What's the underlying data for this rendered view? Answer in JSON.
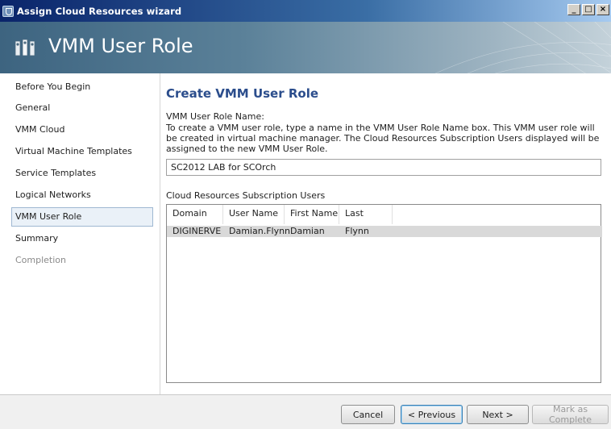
{
  "window": {
    "title": "Assign Cloud Resources wizard",
    "controls": [
      "_",
      "□",
      "×"
    ]
  },
  "banner": {
    "title": "VMM User Role",
    "icon": "users-icon"
  },
  "sidebar": {
    "items": [
      {
        "label": "Before You Begin",
        "state": "normal"
      },
      {
        "label": "General",
        "state": "normal"
      },
      {
        "label": "VMM  Cloud",
        "state": "normal"
      },
      {
        "label": "Virtual Machine Templates",
        "state": "normal"
      },
      {
        "label": "Service Templates",
        "state": "normal"
      },
      {
        "label": "Logical Networks",
        "state": "normal"
      },
      {
        "label": "VMM User Role",
        "state": "active"
      },
      {
        "label": "Summary",
        "state": "normal"
      },
      {
        "label": "Completion",
        "state": "disabled"
      }
    ]
  },
  "main": {
    "heading": "Create VMM User Role",
    "field_label": "VMM User Role Name:",
    "help_text": "To create a VMM user role, type a name in the VMM User Role Name box.  This VMM user role will be created in virtual machine manager.  The Cloud Resources Subscription Users displayed will be assigned to the new VMM User Role.",
    "role_name_value": "SC2012 LAB for SCOrch",
    "list_label": "Cloud Resources Subscription Users",
    "table": {
      "columns": [
        "Domain",
        "User Name",
        "First Name",
        "Last Name"
      ],
      "rows": [
        [
          "DIGINERVE",
          "Damian.Flynn",
          "Damian",
          "Flynn"
        ]
      ]
    }
  },
  "footer": {
    "cancel_label": "Cancel",
    "previous_label": "< Previous",
    "next_label": "Next >",
    "complete_label": "Mark as Complete"
  }
}
